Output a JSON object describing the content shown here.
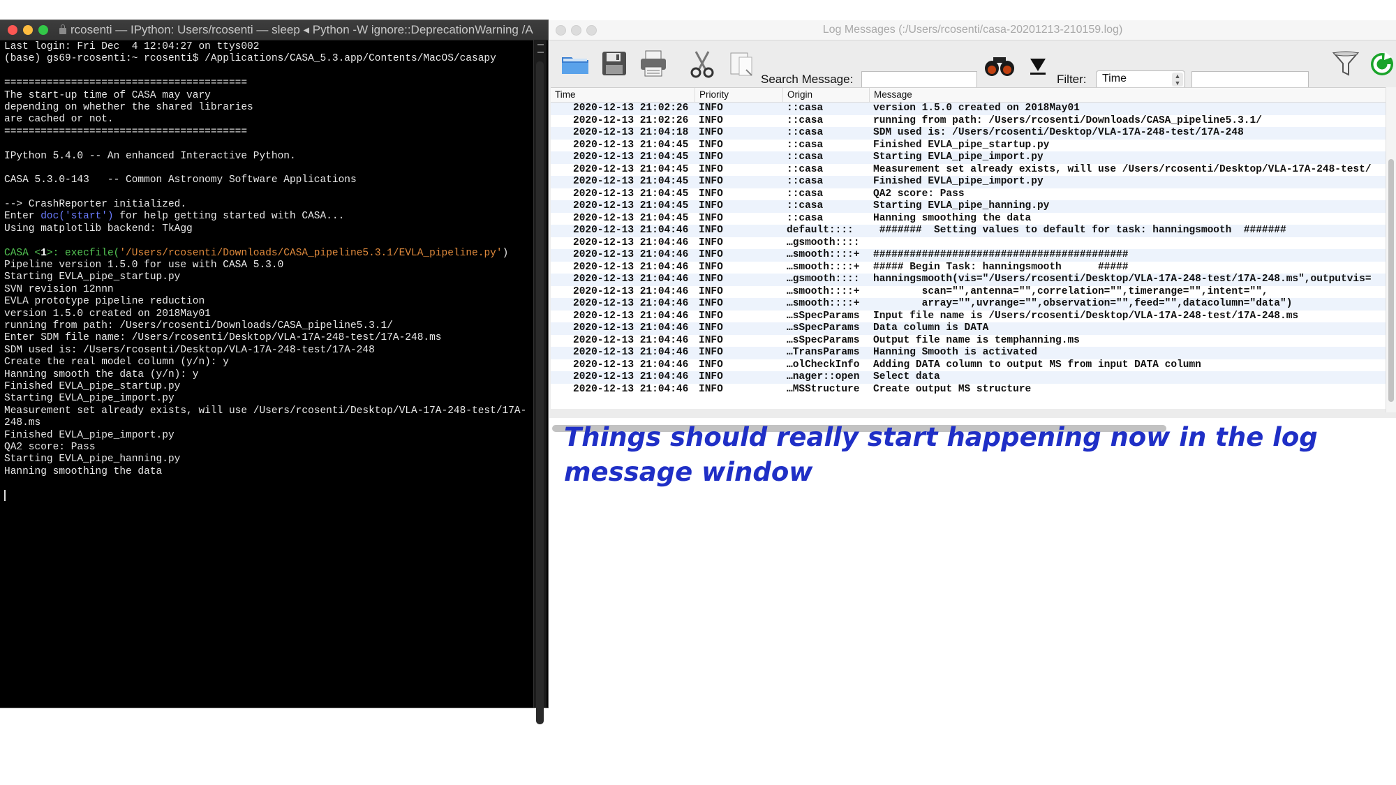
{
  "terminal": {
    "title": "rcosenti — IPython: Users/rcosenti — sleep ◂ Python -W ignore::DeprecationWarning /A...",
    "lines": [
      "Last login: Fri Dec  4 12:04:27 on ttys002",
      "(base) gs69-rcosenti:~ rcosenti$ /Applications/CASA_5.3.app/Contents/MacOS/casapy",
      "",
      "========================================",
      "The start-up time of CASA may vary",
      "depending on whether the shared libraries",
      "are cached or not.",
      "========================================",
      "",
      "IPython 5.4.0 -- An enhanced Interactive Python.",
      "",
      "CASA 5.3.0-143   -- Common Astronomy Software Applications",
      "",
      "--> CrashReporter initialized.",
      "__DOC__",
      "Using matplotlib backend: TkAgg",
      "",
      "__PROMPT__",
      "Pipeline version 1.5.0 for use with CASA 5.3.0",
      "Starting EVLA_pipe_startup.py",
      "SVN revision 12nnn",
      "EVLA prototype pipeline reduction",
      "version 1.5.0 created on 2018May01",
      "running from path: /Users/rcosenti/Downloads/CASA_pipeline5.3.1/",
      "Enter SDM file name: /Users/rcosenti/Desktop/VLA-17A-248-test/17A-248.ms",
      "SDM used is: /Users/rcosenti/Desktop/VLA-17A-248-test/17A-248",
      "Create the real model column (y/n): y",
      "Hanning smooth the data (y/n): y",
      "Finished EVLA_pipe_startup.py",
      "Starting EVLA_pipe_import.py",
      "Measurement set already exists, will use /Users/rcosenti/Desktop/VLA-17A-248-test/17A-",
      "248.ms",
      "Finished EVLA_pipe_import.py",
      "QA2 score: Pass",
      "Starting EVLA_pipe_hanning.py",
      "Hanning smoothing the data",
      "",
      "__CURSOR__"
    ],
    "doc_line": {
      "before": "Enter ",
      "call": "doc('start')",
      "after": " for help getting started with CASA..."
    },
    "prompt_line": {
      "prompt": "CASA <",
      "num": "1",
      "close": ">: ",
      "cmd": "execfile(",
      "arg": "'/Users/rcosenti/Downloads/CASA_pipeline5.3.1/EVLA_pipeline.py'",
      "end": ")"
    }
  },
  "log_window": {
    "title": "Log Messages (:/Users/rcosenti/casa-20201213-210159.log)",
    "search_label": "Search Message:",
    "search_value": "",
    "filter_label": "Filter:",
    "filter_selected": "Time",
    "filter_value": "",
    "columns": [
      "Time",
      "Priority",
      "Origin",
      "Message"
    ],
    "rows": [
      [
        "2020-12-13 21:02:26",
        "INFO",
        "::casa",
        "version 1.5.0 created on 2018May01"
      ],
      [
        "2020-12-13 21:02:26",
        "INFO",
        "::casa",
        "running from path: /Users/rcosenti/Downloads/CASA_pipeline5.3.1/"
      ],
      [
        "2020-12-13 21:04:18",
        "INFO",
        "::casa",
        "SDM used is: /Users/rcosenti/Desktop/VLA-17A-248-test/17A-248"
      ],
      [
        "2020-12-13 21:04:45",
        "INFO",
        "::casa",
        "Finished EVLA_pipe_startup.py"
      ],
      [
        "2020-12-13 21:04:45",
        "INFO",
        "::casa",
        "Starting EVLA_pipe_import.py"
      ],
      [
        "2020-12-13 21:04:45",
        "INFO",
        "::casa",
        "Measurement set already exists, will use /Users/rcosenti/Desktop/VLA-17A-248-test/"
      ],
      [
        "2020-12-13 21:04:45",
        "INFO",
        "::casa",
        "Finished EVLA_pipe_import.py"
      ],
      [
        "2020-12-13 21:04:45",
        "INFO",
        "::casa",
        "QA2 score: Pass"
      ],
      [
        "2020-12-13 21:04:45",
        "INFO",
        "::casa",
        "Starting EVLA_pipe_hanning.py"
      ],
      [
        "2020-12-13 21:04:45",
        "INFO",
        "::casa",
        "Hanning smoothing the data"
      ],
      [
        "2020-12-13 21:04:46",
        "INFO",
        "default::::",
        " #######  Setting values to default for task: hanningsmooth  #######"
      ],
      [
        "2020-12-13 21:04:46",
        "INFO",
        "…gsmooth::::",
        ""
      ],
      [
        "2020-12-13 21:04:46",
        "INFO",
        "…smooth::::+",
        "##########################################"
      ],
      [
        "2020-12-13 21:04:46",
        "INFO",
        "…smooth::::+",
        "##### Begin Task: hanningsmooth      #####"
      ],
      [
        "2020-12-13 21:04:46",
        "INFO",
        "…gsmooth::::",
        "hanningsmooth(vis=\"/Users/rcosenti/Desktop/VLA-17A-248-test/17A-248.ms\",outputvis="
      ],
      [
        "2020-12-13 21:04:46",
        "INFO",
        "…smooth::::+",
        "        scan=\"\",antenna=\"\",correlation=\"\",timerange=\"\",intent=\"\","
      ],
      [
        "2020-12-13 21:04:46",
        "INFO",
        "…smooth::::+",
        "        array=\"\",uvrange=\"\",observation=\"\",feed=\"\",datacolumn=\"data\")"
      ],
      [
        "2020-12-13 21:04:46",
        "INFO",
        "…sSpecParams",
        "Input file name is /Users/rcosenti/Desktop/VLA-17A-248-test/17A-248.ms"
      ],
      [
        "2020-12-13 21:04:46",
        "INFO",
        "…sSpecParams",
        "Data column is DATA"
      ],
      [
        "2020-12-13 21:04:46",
        "INFO",
        "…sSpecParams",
        "Output file name is temphanning.ms"
      ],
      [
        "2020-12-13 21:04:46",
        "INFO",
        "…TransParams",
        "Hanning Smooth is activated"
      ],
      [
        "2020-12-13 21:04:46",
        "INFO",
        "…olCheckInfo",
        "Adding DATA column to output MS from input DATA column"
      ],
      [
        "2020-12-13 21:04:46",
        "INFO",
        "…nager::open",
        "Select data"
      ],
      [
        "2020-12-13 21:04:46",
        "INFO",
        "…MSStructure",
        "Create output MS structure"
      ]
    ]
  },
  "caption": "Things should really start happening now in the log message window",
  "colors": {
    "caption": "#1f2fc6",
    "terminal_bg": "#000000",
    "row_stripe": "#edf3fc"
  }
}
